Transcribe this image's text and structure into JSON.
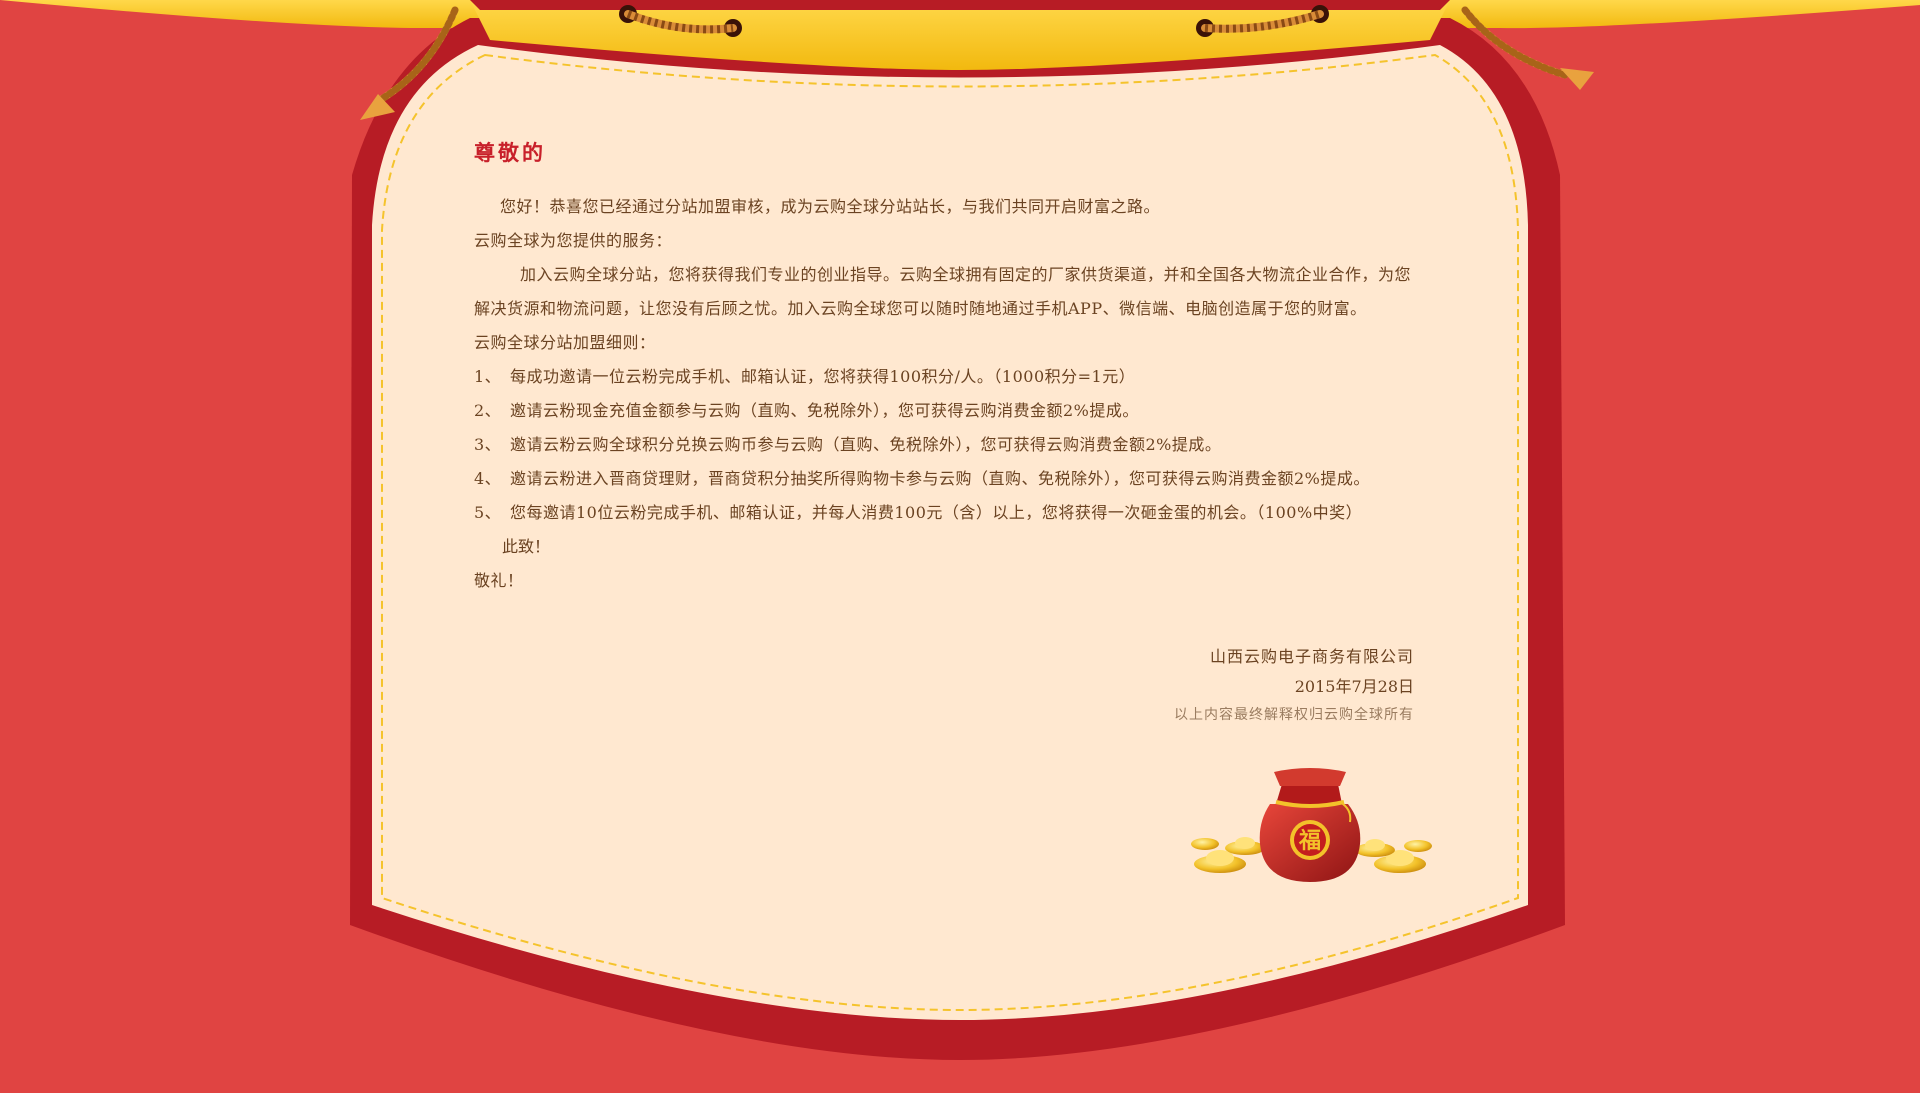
{
  "colors": {
    "background": "#e04442",
    "frame": "#b71c25",
    "paper": "#ffe8d0",
    "banner": "#f7c71a",
    "heading": "#c8202a",
    "body_text": "#6b4322"
  },
  "letter": {
    "greeting": "尊敬的",
    "intro": "您好！恭喜您已经通过分站加盟审核，成为云购全球分站站长，与我们共同开启财富之路。",
    "services_heading": "云购全球为您提供的服务：",
    "services_body": "加入云购全球分站，您将获得我们专业的创业指导。云购全球拥有固定的厂家供货渠道，并和全国各大物流企业合作，为您解决货源和物流问题，让您没有后顾之忧。加入云购全球您可以随时随地通过手机APP、微信端、电脑创造属于您的财富。",
    "rules_heading": "云购全球分站加盟细则：",
    "rules": [
      {
        "num": "1、",
        "text": "每成功邀请一位云粉完成手机、邮箱认证，您将获得100积分/人。（1000积分=1元）"
      },
      {
        "num": "2、",
        "text": "邀请云粉现金充值金额参与云购（直购、免税除外），您可获得云购消费金额2%提成。"
      },
      {
        "num": "3、",
        "text": "邀请云粉云购全球积分兑换云购币参与云购（直购、免税除外），您可获得云购消费金额2%提成。"
      },
      {
        "num": "4、",
        "text": "邀请云粉进入晋商贷理财，晋商贷积分抽奖所得购物卡参与云购（直购、免税除外），您可获得云购消费金额2%提成。"
      },
      {
        "num": "5、",
        "text": "您每邀请10位云粉完成手机、邮箱认证，并每人消费100元（含）以上，您将获得一次砸金蛋的机会。（100%中奖）"
      }
    ],
    "closing_1": "此致！",
    "closing_2": "敬礼！"
  },
  "signature": {
    "company": "山西云购电子商务有限公司",
    "date": "2015年7月28日",
    "note": "以上内容最终解释权归云购全球所有"
  },
  "decoration": {
    "bag_character": "福",
    "bag_icon": "lucky-bag-icon",
    "ingot_icon": "gold-ingot-icon"
  }
}
